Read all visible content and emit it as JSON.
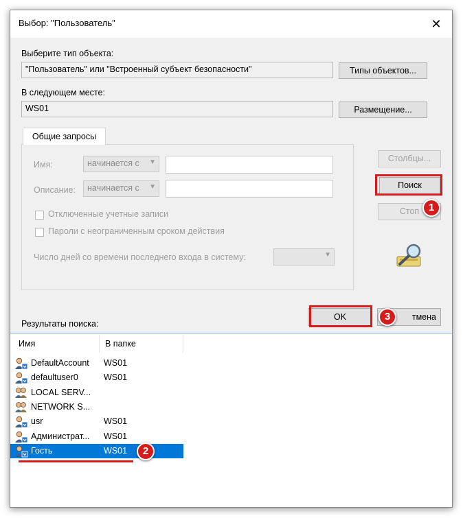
{
  "window": {
    "title": "Выбор: \"Пользователь\""
  },
  "object_type": {
    "label": "Выберите тип объекта:",
    "value": "\"Пользователь\" или \"Встроенный субъект безопасности\"",
    "button": "Типы объектов..."
  },
  "location": {
    "label": "В следующем месте:",
    "value": "WS01",
    "button": "Размещение..."
  },
  "tab": {
    "label": "Общие запросы"
  },
  "query": {
    "name_label": "Имя:",
    "name_mode": "начинается с",
    "desc_label": "Описание:",
    "desc_mode": "начинается с",
    "disabled_accounts": "Отключенные учетные записи",
    "no_expire": "Пароли с неограниченным сроком действия",
    "days_label": "Число дней со времени последнего входа в систему:"
  },
  "side_buttons": {
    "columns": "Столбцы...",
    "search": "Поиск",
    "stop": "Стоп"
  },
  "dialog_buttons": {
    "ok": "OK",
    "cancel": "Отмена",
    "cancel_visible": "тмена"
  },
  "results": {
    "label": "Результаты поиска:",
    "columns": [
      "Имя",
      "В папке"
    ],
    "rows": [
      {
        "name": "DefaultAccount",
        "folder": "WS01",
        "icon": "user-icon"
      },
      {
        "name": "defaultuser0",
        "folder": "WS01",
        "icon": "user-icon"
      },
      {
        "name": "LOCAL SERV...",
        "folder": "",
        "icon": "group-icon"
      },
      {
        "name": "NETWORK S...",
        "folder": "",
        "icon": "group-icon"
      },
      {
        "name": "usr",
        "folder": "WS01",
        "icon": "user-icon"
      },
      {
        "name": "Администрат...",
        "folder": "WS01",
        "icon": "user-icon"
      },
      {
        "name": "Гость",
        "folder": "WS01",
        "icon": "user-icon",
        "selected": true
      }
    ]
  },
  "annotations": {
    "badge1": "1",
    "badge2": "2",
    "badge3": "3"
  },
  "colors": {
    "accent_red": "#d51b1b",
    "selection_blue": "#0078d7"
  }
}
